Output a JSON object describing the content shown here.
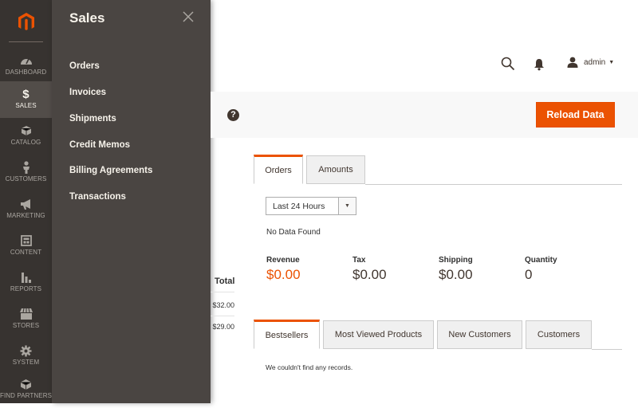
{
  "nav": {
    "items": [
      {
        "label": "DASHBOARD",
        "icon": "dashboard-icon"
      },
      {
        "label": "SALES",
        "icon": "dollar-icon"
      },
      {
        "label": "CATALOG",
        "icon": "box-icon"
      },
      {
        "label": "CUSTOMERS",
        "icon": "person-icon"
      },
      {
        "label": "MARKETING",
        "icon": "megaphone-icon"
      },
      {
        "label": "CONTENT",
        "icon": "content-icon"
      },
      {
        "label": "REPORTS",
        "icon": "bar-chart-icon"
      },
      {
        "label": "STORES",
        "icon": "store-icon"
      },
      {
        "label": "SYSTEM",
        "icon": "gear-icon"
      },
      {
        "label": "FIND PARTNERS",
        "icon": "partners-icon"
      }
    ],
    "active": "SALES",
    "colors": {
      "bg": "#373330",
      "active_bg": "#524d49",
      "logo": "#eb5202"
    }
  },
  "submenu": {
    "title": "Sales",
    "items": [
      "Orders",
      "Invoices",
      "Shipments",
      "Credit Memos",
      "Billing Agreements",
      "Transactions"
    ]
  },
  "header": {
    "user": "admin"
  },
  "actions": {
    "help": "?",
    "reload": "Reload Data"
  },
  "last_orders": {
    "total_header": "Total",
    "values": [
      "$32.00",
      "$29.00"
    ]
  },
  "chart_tabs": [
    "Orders",
    "Amounts"
  ],
  "period": {
    "selected": "Last 24 Hours"
  },
  "no_data": "No Data Found",
  "totals": [
    {
      "label": "Revenue",
      "value": "$0.00"
    },
    {
      "label": "Tax",
      "value": "$0.00"
    },
    {
      "label": "Shipping",
      "value": "$0.00"
    },
    {
      "label": "Quantity",
      "value": "0"
    }
  ],
  "grid_tabs": [
    "Bestsellers",
    "Most Viewed Products",
    "New Customers",
    "Customers"
  ],
  "no_records": "We couldn't find any records.",
  "accent": "#eb5202"
}
